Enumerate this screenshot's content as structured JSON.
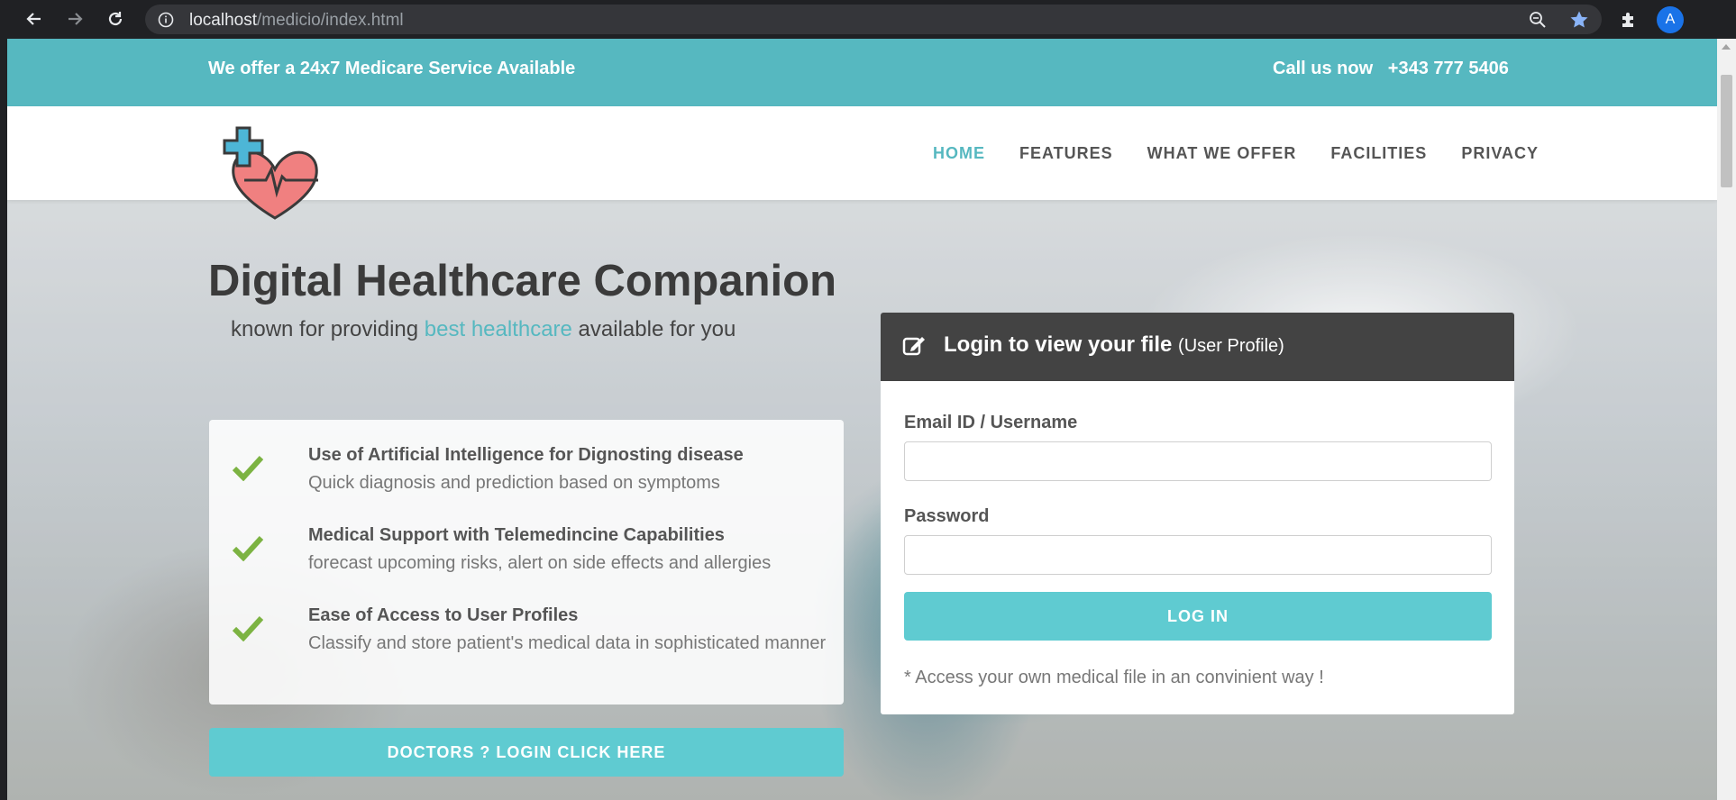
{
  "browser": {
    "url_host": "localhost",
    "url_path": "/medicio/index.html",
    "avatar_letter": "A"
  },
  "topbar": {
    "left_text": "We offer a 24x7 Medicare Service Available",
    "call_label": "Call us now",
    "phone": "+343 777 5406"
  },
  "nav": {
    "items": [
      {
        "label": "HOME"
      },
      {
        "label": "FEATURES"
      },
      {
        "label": "WHAT WE OFFER"
      },
      {
        "label": "FACILITIES"
      },
      {
        "label": "PRIVACY"
      }
    ],
    "active_item": "HOME"
  },
  "hero": {
    "title": "Digital Healthcare Companion",
    "subtitle_pre": "known for providing ",
    "subtitle_highlight": "best healthcare",
    "subtitle_post": " available for you"
  },
  "features": [
    {
      "title": "Use of Artificial Intelligence for Dignosting disease",
      "desc": "Quick diagnosis and prediction based on symptoms"
    },
    {
      "title": "Medical Support with Telemedincine Capabilities",
      "desc": "forecast upcoming risks, alert on side effects and allergies"
    },
    {
      "title": "Ease of Access to User Profiles",
      "desc": "Classify and store patient's medical data in sophisticated manner"
    }
  ],
  "doctors_button": "DOCTORS ? LOGIN CLICK HERE",
  "login": {
    "title": "Login to view your file",
    "title_suffix": "(User Profile)",
    "email_label": "Email ID / Username",
    "email_value": "",
    "password_label": "Password",
    "password_value": "",
    "button": "LOG IN",
    "note": "* Access your own medical file in an convinient way !"
  },
  "colors": {
    "accent": "#56b8c0",
    "button": "#5fcbd1",
    "panel_header": "#434343",
    "check": "#7cb342"
  },
  "icons": [
    "back-arrow-icon",
    "forward-arrow-icon",
    "reload-icon",
    "info-icon",
    "zoom-icon",
    "star-icon",
    "puzzle-icon",
    "edit-icon",
    "check-icon",
    "heart-logo-icon"
  ]
}
